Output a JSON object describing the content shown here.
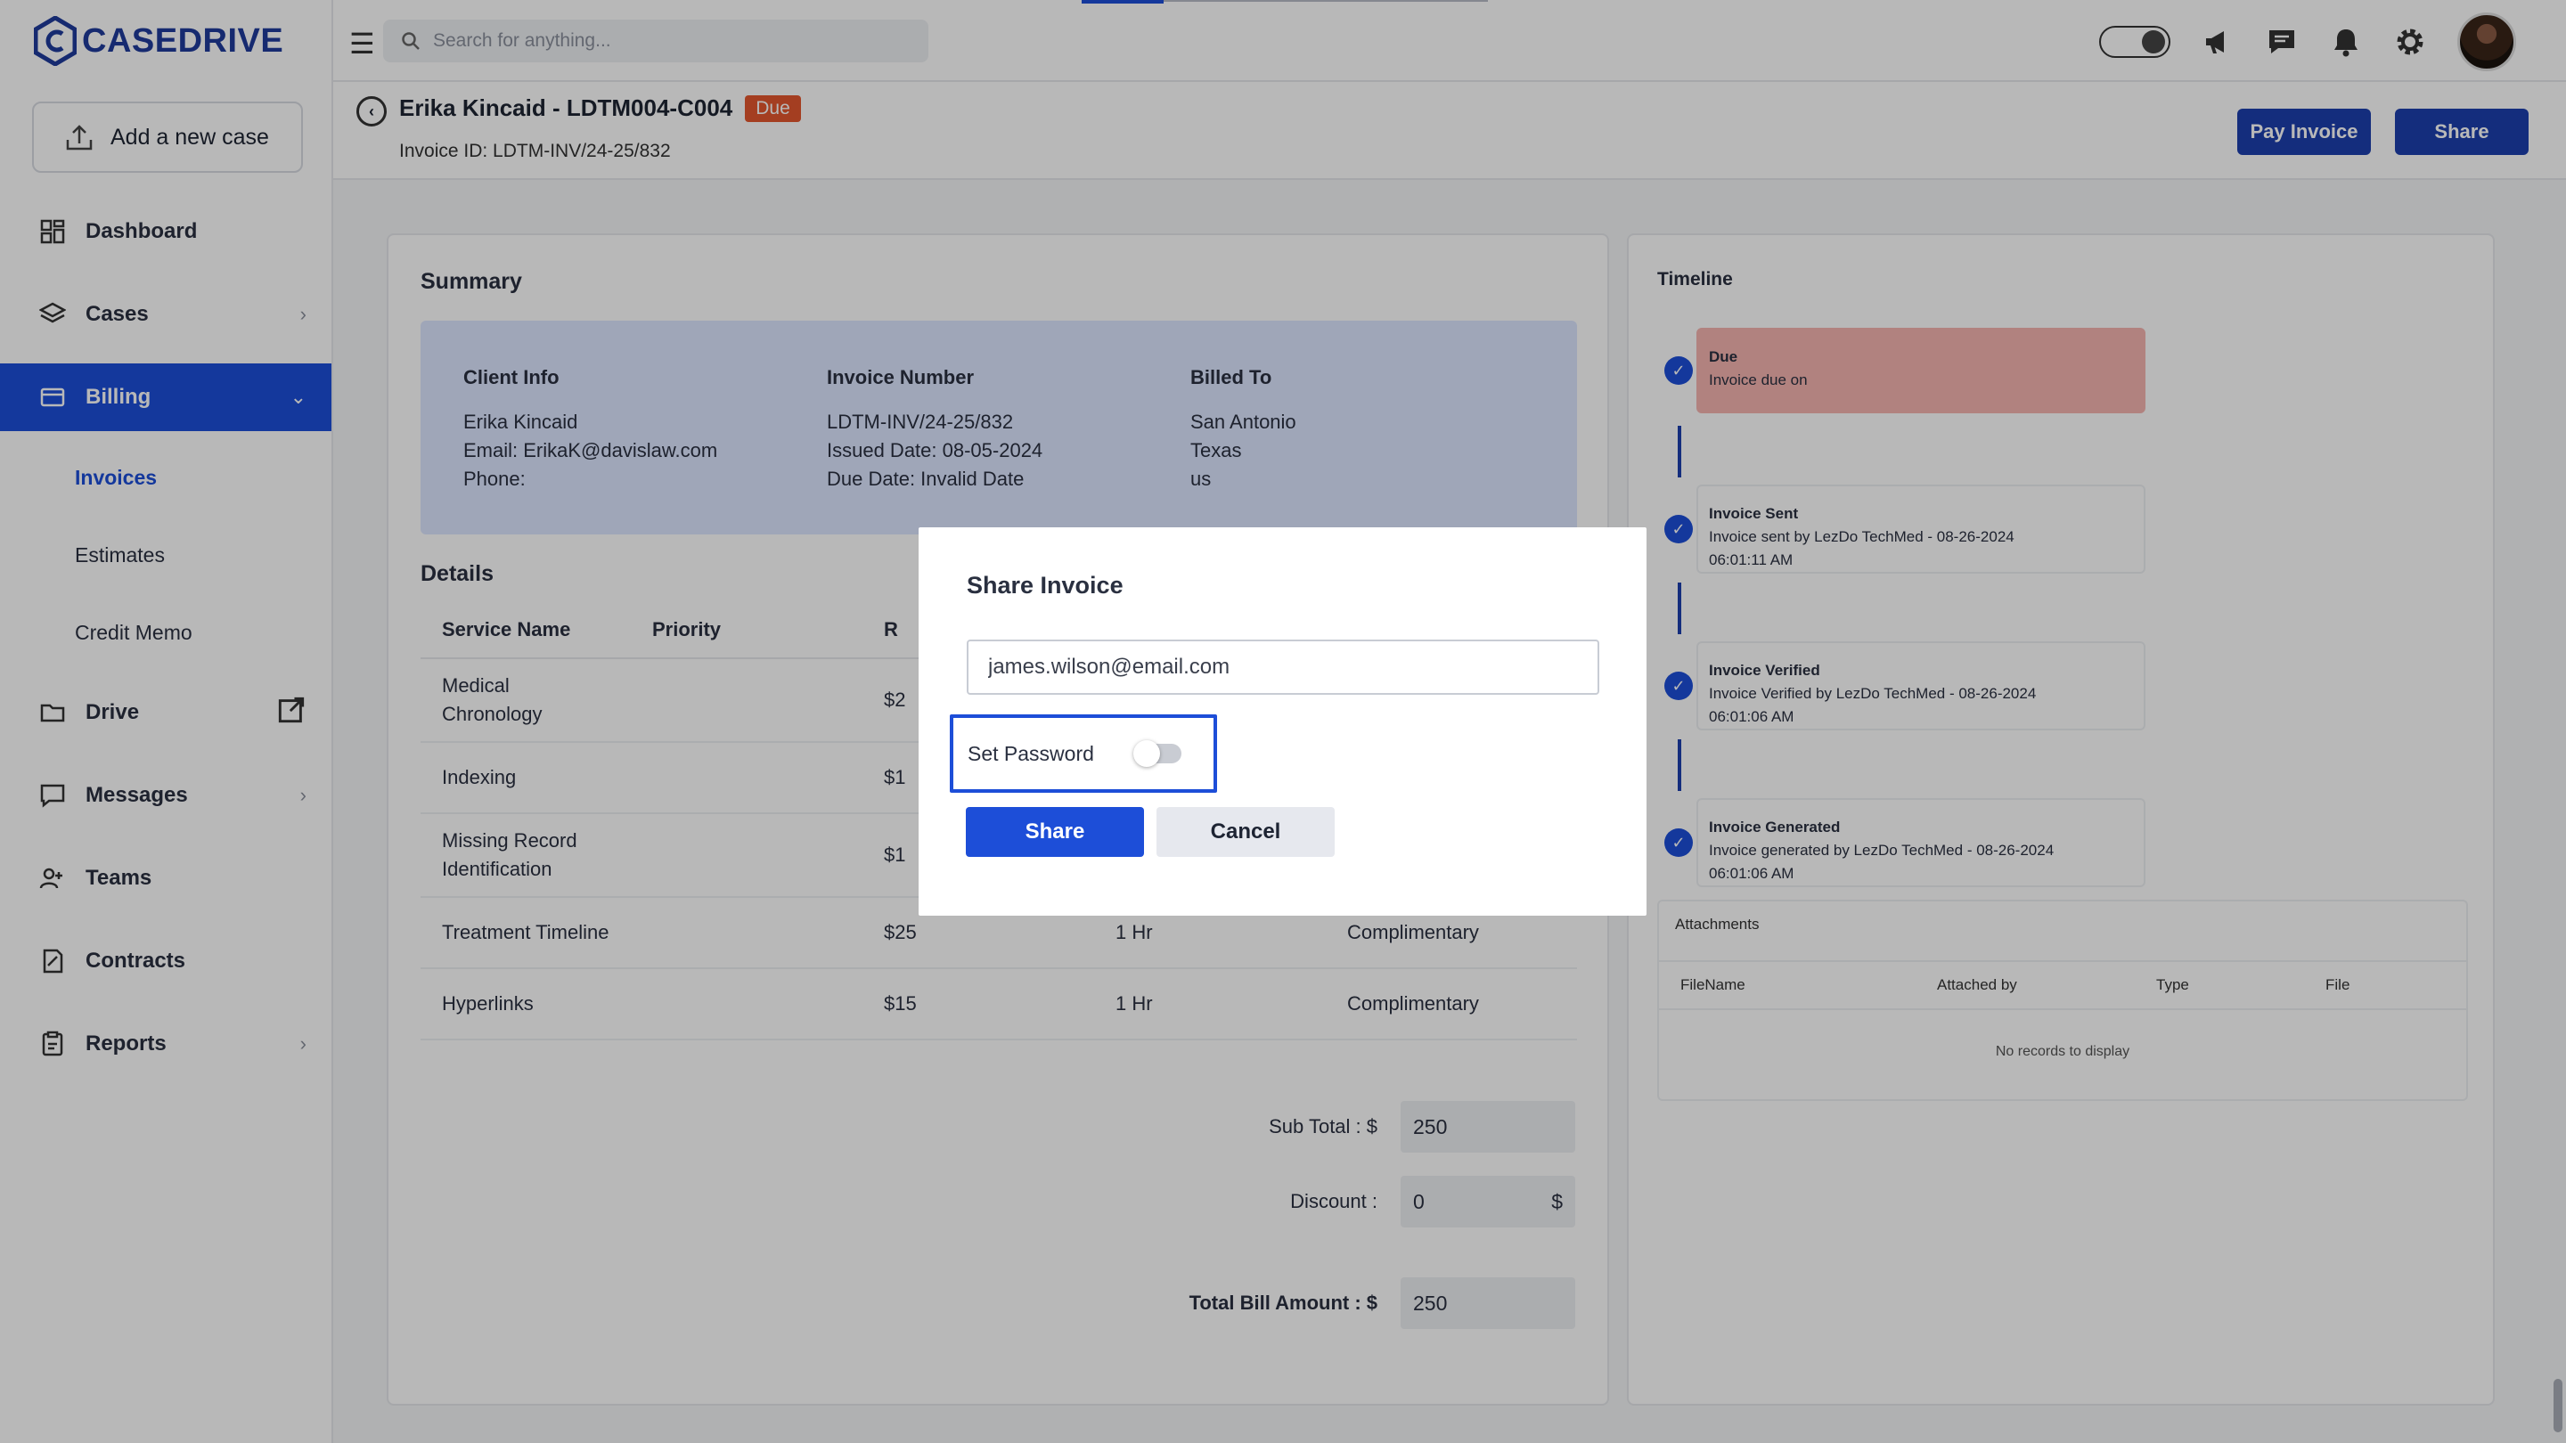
{
  "app": {
    "brand": "CASEDRIVE",
    "brand_color": "#1f3b9c",
    "accent": "#1d4ed8"
  },
  "sidebar": {
    "add_case_label": "Add a new case",
    "items": [
      {
        "label": "Dashboard",
        "icon": "dashboard-icon"
      },
      {
        "label": "Cases",
        "icon": "layers-icon"
      },
      {
        "label": "Billing",
        "icon": "billing-icon",
        "active": true
      },
      {
        "label": "Drive",
        "icon": "folder-icon"
      },
      {
        "label": "Messages",
        "icon": "message-icon"
      },
      {
        "label": "Teams",
        "icon": "teams-icon"
      },
      {
        "label": "Contracts",
        "icon": "contract-icon"
      },
      {
        "label": "Reports",
        "icon": "report-icon"
      }
    ],
    "billing_sub": [
      "Invoices",
      "Estimates",
      "Credit Memo"
    ]
  },
  "topbar": {
    "search_placeholder": "Search for anything..."
  },
  "header": {
    "title": "Erika Kincaid - LDTM004-C004",
    "status": "Due",
    "invoice_id": "Invoice ID: LDTM-INV/24-25/832",
    "pay_label": "Pay Invoice",
    "share_label": "Share"
  },
  "summary": {
    "title": "Summary",
    "client": {
      "heading": "Client Info",
      "name": "Erika Kincaid",
      "email": "Email: ErikaK@davislaw.com",
      "phone": "Phone:"
    },
    "invoice": {
      "heading": "Invoice Number",
      "number": "LDTM-INV/24-25/832",
      "issued": "Issued Date: 08-05-2024",
      "due": "Due Date: Invalid Date"
    },
    "billed": {
      "heading": "Billed To",
      "city": "San Antonio",
      "state": "Texas",
      "country": "us"
    }
  },
  "details": {
    "title": "Details",
    "columns": [
      "Service Name",
      "Priority",
      "R"
    ],
    "rows": [
      {
        "name": "Medical Chronology",
        "rate": "$2"
      },
      {
        "name": "Indexing",
        "rate": "$1"
      },
      {
        "name": "Missing Record Identification",
        "rate": "$1"
      },
      {
        "name": "Treatment Timeline",
        "rate": "$25",
        "duration": "1 Hr",
        "note": "Complimentary"
      },
      {
        "name": "Hyperlinks",
        "rate": "$15",
        "duration": "1 Hr",
        "note": "Complimentary"
      }
    ],
    "subtotal_label": "Sub Total : $",
    "subtotal": "250",
    "discount_label": "Discount :",
    "discount": "0",
    "discount_unit": "$",
    "total_label": "Total Bill Amount : $",
    "total": "250"
  },
  "timeline": {
    "title": "Timeline",
    "events": [
      {
        "title": "Due",
        "desc": "Invoice due on",
        "time": ""
      },
      {
        "title": "Invoice Sent",
        "desc": "Invoice sent by LezDo TechMed - 08-26-2024",
        "time": "06:01:11 AM"
      },
      {
        "title": "Invoice Verified",
        "desc": "Invoice Verified by LezDo TechMed - 08-26-2024",
        "time": "06:01:06 AM"
      },
      {
        "title": "Invoice Generated",
        "desc": "Invoice generated by LezDo TechMed - 08-26-2024",
        "time": "06:01:06 AM"
      }
    ],
    "attachments": {
      "title": "Attachments",
      "columns": [
        "FileName",
        "Attached by",
        "Type",
        "File"
      ],
      "empty": "No records to display"
    }
  },
  "modal": {
    "title": "Share Invoice",
    "email_value": "james.wilson@email.com",
    "password_label": "Set Password",
    "password_enabled": false,
    "share_label": "Share",
    "cancel_label": "Cancel"
  }
}
